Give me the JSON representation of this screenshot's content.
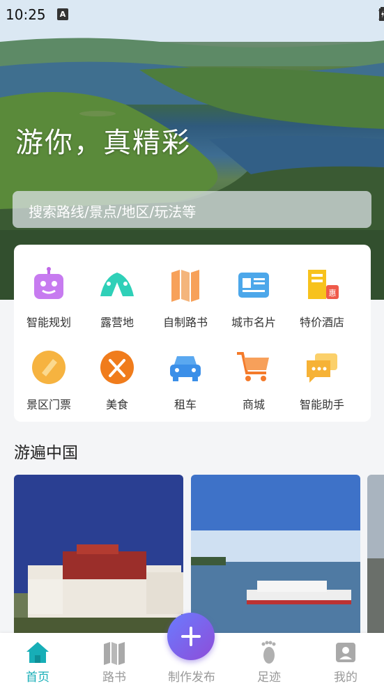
{
  "status_bar": {
    "time": "10:25",
    "notice_letter": "A"
  },
  "hero": {
    "slogan": "游你，真精彩",
    "search_placeholder": "搜索路线/景点/地区/玩法等"
  },
  "services": [
    {
      "label": "智能规划",
      "icon": "robot-icon"
    },
    {
      "label": "露营地",
      "icon": "tent-icon"
    },
    {
      "label": "自制路书",
      "icon": "map-book-icon"
    },
    {
      "label": "城市名片",
      "icon": "city-card-icon"
    },
    {
      "label": "特价酒店",
      "icon": "hotel-discount-icon"
    },
    {
      "label": "景区门票",
      "icon": "ticket-icon"
    },
    {
      "label": "美食",
      "icon": "food-icon"
    },
    {
      "label": "租车",
      "icon": "car-icon"
    },
    {
      "label": "商城",
      "icon": "cart-icon"
    },
    {
      "label": "智能助手",
      "icon": "chat-assistant-icon"
    }
  ],
  "hotel_badge": "惠",
  "section": {
    "title": "游遍中国"
  },
  "tabbar": {
    "items": [
      {
        "label": "首页",
        "icon": "home-icon",
        "active": true
      },
      {
        "label": "路书",
        "icon": "map-icon",
        "active": false
      },
      {
        "label": "制作发布",
        "icon": "plus-icon",
        "active": false
      },
      {
        "label": "足迹",
        "icon": "footprint-icon",
        "active": false
      },
      {
        "label": "我的",
        "icon": "profile-icon",
        "active": false
      }
    ]
  },
  "colors": {
    "accent": "#17aeb7",
    "fab_start": "#6a7bff",
    "fab_end": "#8e4dd8"
  }
}
